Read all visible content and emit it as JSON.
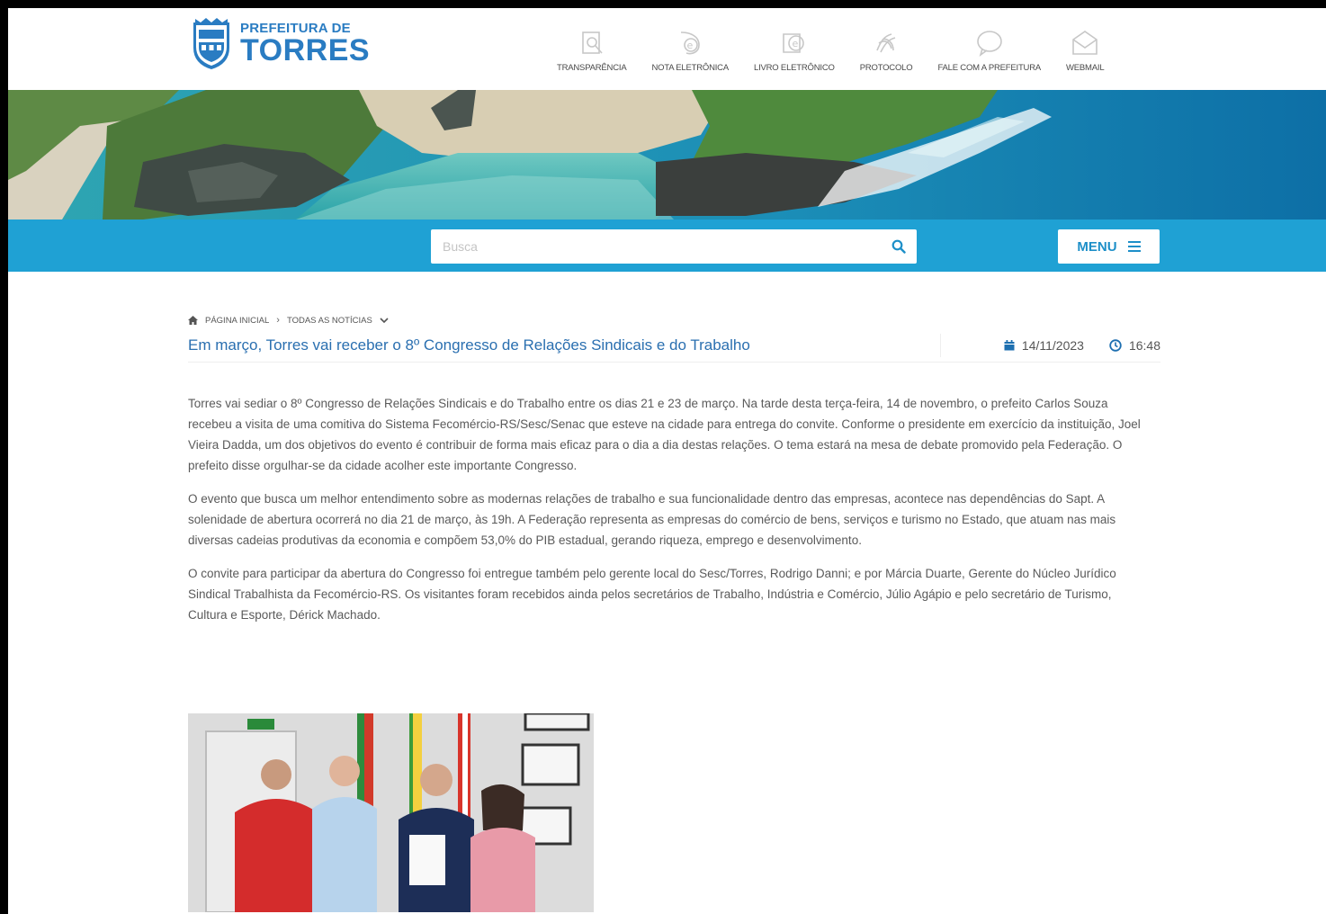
{
  "header": {
    "logo_line1": "PREFEITURA DE",
    "logo_line2": "TORRES",
    "nav": [
      {
        "label": "TRANSPARÊNCIA",
        "icon": "document-search-icon"
      },
      {
        "label": "NOTA ELETRÔNICA",
        "icon": "e-invoice-icon"
      },
      {
        "label": "LIVRO ELETRÔNICO",
        "icon": "e-book-icon"
      },
      {
        "label": "PROTOCOLO",
        "icon": "fingerprint-icon"
      },
      {
        "label": "FALE COM A PREFEITURA",
        "icon": "speech-bubble-icon"
      },
      {
        "label": "WEBMAIL",
        "icon": "envelope-icon"
      }
    ]
  },
  "search": {
    "placeholder": "Busca",
    "value": ""
  },
  "menu": {
    "label": "MENU"
  },
  "breadcrumb": {
    "home": "PÁGINA INICIAL",
    "section": "TODAS AS NOTÍCIAS"
  },
  "article": {
    "title": "Em março, Torres vai receber o 8º Congresso de Relações Sindicais e do Trabalho",
    "date": "14/11/2023",
    "time": "16:48",
    "paragraphs": [
      "Torres vai sediar o 8º Congresso de Relações Sindicais e do Trabalho entre os dias 21 e 23 de março. Na tarde desta terça-feira, 14 de novembro, o prefeito Carlos Souza recebeu a visita de uma comitiva do Sistema Fecomércio-RS/Sesc/Senac que esteve na cidade para entrega do convite. Conforme o presidente em exercício da instituição, Joel Vieira Dadda, um dos objetivos do evento é contribuir de forma mais eficaz para o dia a dia destas relações. O tema estará na mesa de debate promovido pela Federação. O prefeito disse orgulhar-se da cidade acolher este importante Congresso.",
      "O evento que busca um melhor entendimento sobre as modernas relações de trabalho e sua funcionalidade dentro das empresas, acontece nas dependências do Sapt. A solenidade de abertura ocorrerá no dia 21 de março, às 19h. A Federação representa as empresas do comércio de bens, serviços e turismo no Estado, que atuam nas mais diversas cadeias produtivas da economia e compõem 53,0% do PIB estadual, gerando riqueza, emprego e desenvolvimento.",
      "O convite para participar da abertura do Congresso foi entregue também pelo gerente local do Sesc/Torres, Rodrigo Danni; e por Márcia Duarte, Gerente do Núcleo Jurídico Sindical Trabalhista da Fecomércio-RS. Os visitantes foram recebidos ainda pelos secretários de Trabalho, Indústria e Comércio, Júlio Agápio e pelo secretário de Turismo, Cultura e Esporte, Dérick Machado."
    ]
  },
  "colors": {
    "brand_blue": "#2a7cc2",
    "bar_blue": "#1fa1d4",
    "title_blue": "#2a6fb0"
  }
}
